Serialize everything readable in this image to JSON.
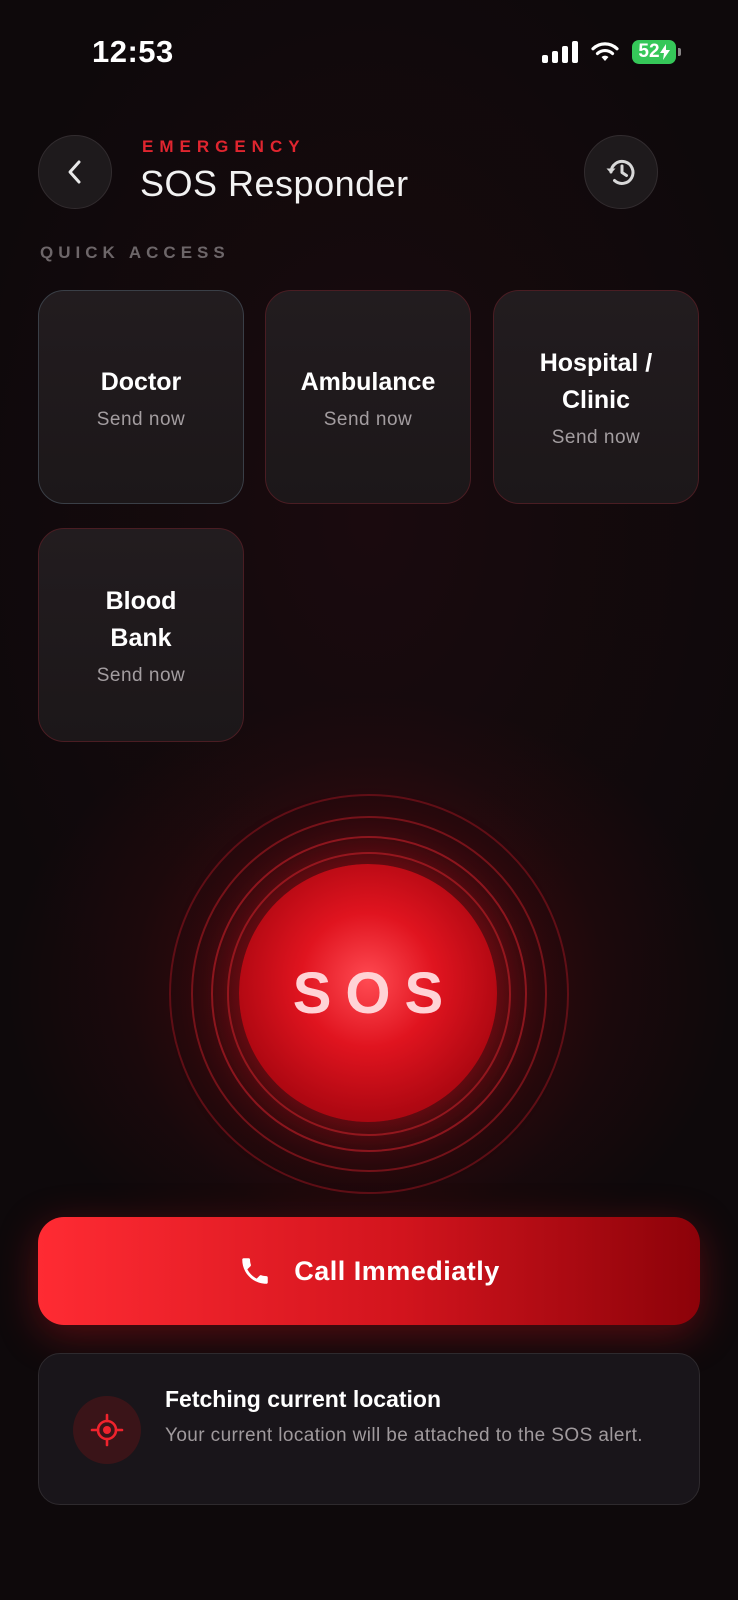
{
  "status_bar": {
    "time": "12:53",
    "battery": "52"
  },
  "header": {
    "eyebrow": "EMERGENCY",
    "title": "SOS Responder",
    "back_icon": "chevron-left-icon",
    "history_icon": "history-icon"
  },
  "quick_access": {
    "label": "QUICK ACCESS",
    "items": [
      {
        "title": "Doctor",
        "subtitle": "Send now",
        "selected": true
      },
      {
        "title": "Ambulance",
        "subtitle": "Send now",
        "selected": false
      },
      {
        "title": "Hospital / Clinic",
        "subtitle": "Send now",
        "selected": false
      },
      {
        "title": "Blood Bank",
        "subtitle": "Send now",
        "selected": false
      }
    ]
  },
  "sos": {
    "label": "SOS"
  },
  "call_button": {
    "label": "Call Immediatly",
    "icon": "phone-icon"
  },
  "location": {
    "title": "Fetching current location",
    "description": "Your current location will be attached to the SOS alert.",
    "icon": "crosshair-icon"
  },
  "colors": {
    "accent": "#e0252f",
    "background": "#0d0a0c",
    "card_border": "#4a1d23",
    "battery": "#35c759"
  }
}
